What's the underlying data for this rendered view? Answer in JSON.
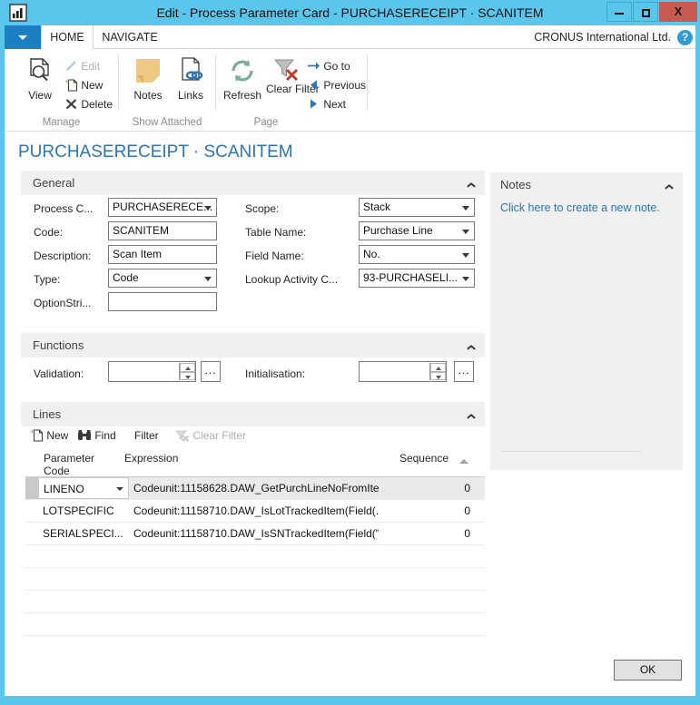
{
  "window": {
    "title": "Edit - Process Parameter Card - PURCHASERECEIPT · SCANITEM",
    "app_icon": "chart-app-icon",
    "minimize_label": "",
    "maximize_label": "",
    "close_label": "X"
  },
  "tabs": {
    "quick_access_label": "",
    "items": [
      {
        "label": "HOME",
        "active": true
      },
      {
        "label": "NAVIGATE",
        "active": false
      }
    ],
    "company": "CRONUS International Ltd.",
    "help_label": "?"
  },
  "ribbon": {
    "groups": [
      {
        "label": "Manage",
        "big": [
          {
            "label": "View",
            "icon": "view-document-search-icon"
          }
        ],
        "small": [
          {
            "label": "Edit",
            "icon": "pencil-icon",
            "disabled": true
          },
          {
            "label": "New",
            "icon": "new-document-icon",
            "disabled": false
          },
          {
            "label": "Delete",
            "icon": "delete-x-icon",
            "disabled": false
          }
        ]
      },
      {
        "label": "Show Attached",
        "big": [
          {
            "label": "Notes",
            "icon": "sticky-note-icon"
          },
          {
            "label": "Links",
            "icon": "link-document-icon"
          }
        ],
        "small": []
      },
      {
        "label": "Page",
        "big": [
          {
            "label": "Refresh",
            "icon": "refresh-icon"
          },
          {
            "label": "Clear Filter",
            "icon": "clear-filter-icon"
          }
        ],
        "small": [
          {
            "label": "Go to",
            "icon": "arrow-right-icon",
            "disabled": false
          },
          {
            "label": "Previous",
            "icon": "arrow-left-icon",
            "disabled": false
          },
          {
            "label": "Next",
            "icon": "arrow-right-solid-icon",
            "disabled": false
          }
        ]
      }
    ]
  },
  "page": {
    "title": "PURCHASERECEIPT · SCANITEM"
  },
  "general": {
    "header": "General",
    "left_fields": [
      {
        "label": "Process C...",
        "value": "PURCHASERECE...",
        "type": "dropdown"
      },
      {
        "label": "Code:",
        "value": "SCANITEM",
        "type": "text"
      },
      {
        "label": "Description:",
        "value": "Scan Item",
        "type": "text"
      },
      {
        "label": "Type:",
        "value": "Code",
        "type": "dropdown"
      },
      {
        "label": "OptionStri...",
        "value": "",
        "type": "text"
      }
    ],
    "right_fields": [
      {
        "label": "Scope:",
        "value": "Stack",
        "type": "dropdown"
      },
      {
        "label": "Table Name:",
        "value": "Purchase Line",
        "type": "dropdown"
      },
      {
        "label": "Field Name:",
        "value": "No.",
        "type": "dropdown"
      },
      {
        "label": "Lookup Activity C...",
        "value": "93-PURCHASELI...",
        "type": "dropdown"
      }
    ]
  },
  "functions": {
    "header": "Functions",
    "fields": [
      {
        "label": "Validation:",
        "value": "",
        "ellipsis_label": "..."
      },
      {
        "label": "Initialisation:",
        "value": "",
        "ellipsis_label": "..."
      }
    ]
  },
  "lines": {
    "header": "Lines",
    "toolbar": [
      {
        "label": "New",
        "icon": "new-document-icon",
        "disabled": false
      },
      {
        "label": "Find",
        "icon": "binoculars-icon",
        "disabled": false
      },
      {
        "label": "Filter",
        "icon": "",
        "disabled": false
      },
      {
        "label": "Clear Filter",
        "icon": "clear-filter-small-icon",
        "disabled": true
      }
    ],
    "columns": [
      {
        "label": "Parameter Code",
        "sorted": false
      },
      {
        "label": "Expression",
        "sorted": false
      },
      {
        "label": "Sequence",
        "sorted": true
      }
    ],
    "rows": [
      {
        "parameter_code": "LINENO",
        "expression": "Codeunit:11158628.DAW_GetPurchLineNoFromIte...",
        "sequence": "0",
        "selected": true
      },
      {
        "parameter_code": "LOTSPECIFIC",
        "expression": "Codeunit:11158710.DAW_IsLotTrackedItem(Field(...",
        "sequence": "0",
        "selected": false
      },
      {
        "parameter_code": "SERIALSPECI...",
        "expression": "Codeunit:11158710.DAW_IsSNTrackedItem(Field(\"...",
        "sequence": "0",
        "selected": false
      }
    ],
    "empty_row_count": 7
  },
  "notes": {
    "header": "Notes",
    "link": "Click here to create a new note."
  },
  "footer": {
    "ok_label": "OK"
  },
  "colors": {
    "window_chrome": "#5BC6EC",
    "accent_blue": "#1C7FC4",
    "title_link": "#2E75B6",
    "close_red": "#C75B52",
    "section_bg": "#F0F0F0"
  }
}
